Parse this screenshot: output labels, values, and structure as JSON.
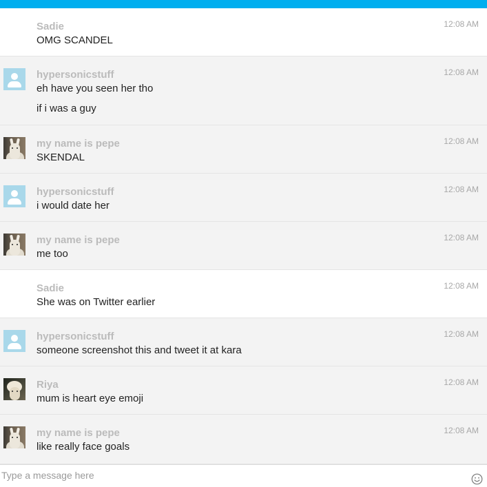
{
  "colors": {
    "accent": "#00aeef",
    "row_grey": "#f3f3f3",
    "row_white": "#ffffff",
    "sender_text": "#bbbbbb",
    "message_text": "#222222",
    "timestamp_text": "#a8a8a8"
  },
  "messages": [
    {
      "sender": "Sadie",
      "avatar": "none",
      "time": "12:08 AM",
      "lines": [
        "OMG SCANDEL"
      ]
    },
    {
      "sender": "hypersonicstuff",
      "avatar": "default-user-icon",
      "time": "12:08 AM",
      "lines": [
        "eh have you seen her tho",
        "if i was a guy"
      ]
    },
    {
      "sender": "my name is pepe",
      "avatar": "llama-photo",
      "time": "12:08 AM",
      "lines": [
        "SKENDAL"
      ]
    },
    {
      "sender": "hypersonicstuff",
      "avatar": "default-user-icon",
      "time": "12:08 AM",
      "lines": [
        "i would date her"
      ]
    },
    {
      "sender": "my name is pepe",
      "avatar": "llama-photo",
      "time": "12:08 AM",
      "lines": [
        "me too"
      ]
    },
    {
      "sender": "Sadie",
      "avatar": "none",
      "time": "12:08 AM",
      "lines": [
        "She was on Twitter earlier"
      ]
    },
    {
      "sender": "hypersonicstuff",
      "avatar": "default-user-icon",
      "time": "12:08 AM",
      "lines": [
        "someone screenshot this and tweet it at kara"
      ]
    },
    {
      "sender": "Riya",
      "avatar": "alpaca-photo",
      "time": "12:08 AM",
      "lines": [
        "mum is heart eye emoji"
      ]
    },
    {
      "sender": "my name is pepe",
      "avatar": "llama-photo",
      "time": "12:08 AM",
      "lines": [
        "like really face goals"
      ]
    }
  ],
  "composer": {
    "placeholder": "Type a message here",
    "emoji_icon": "smiley-icon"
  }
}
